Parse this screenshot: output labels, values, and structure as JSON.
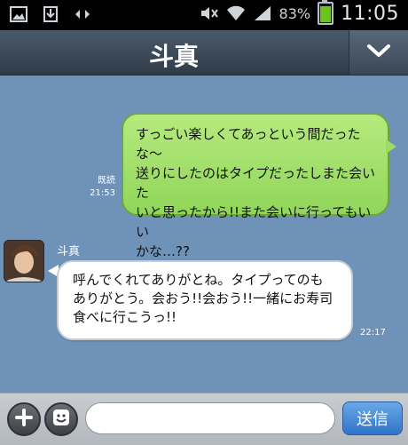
{
  "status_bar": {
    "battery_percent": "83%",
    "battery_level": 0.83,
    "time": "11:05",
    "icons": [
      "image-icon",
      "download-box-icon",
      "double-arrow-icon",
      "mute-icon",
      "wifi-icon",
      "signal-icon",
      "battery-icon"
    ]
  },
  "header": {
    "title": "斗真",
    "dropdown_icon": "chevron-down-icon"
  },
  "messages": {
    "outgoing": {
      "read_label": "既読",
      "time": "21:53",
      "lines": [
        "すっごい楽しくてあっという間だったな〜",
        "送りにしたのはタイプだったしまた会いた",
        "いと思ったから!!また会いに行ってもいい",
        "かな…??"
      ]
    },
    "incoming": {
      "sender": "斗真",
      "time": "22:17",
      "lines": [
        "呼んでくれてありがとね。タイプってのも",
        "ありがとう。会おう!!会おう!!一緒にお寿司",
        "食べに行こうっ!!"
      ]
    }
  },
  "input_bar": {
    "plus_icon": "plus-icon",
    "emoji_icon": "emoji-icon",
    "input_value": "",
    "input_placeholder": "",
    "send_label": "送信"
  },
  "colors": {
    "chat_background": "#6f92b8",
    "outgoing_bubble": "#9bdc64",
    "header": "#3a4756",
    "send_button": "#2f74c8"
  }
}
